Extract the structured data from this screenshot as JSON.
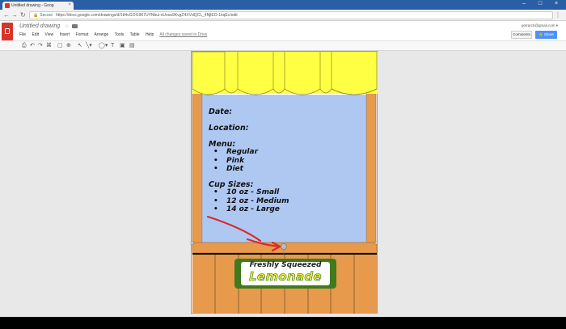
{
  "browser": {
    "tab_title": "Untitled drawing - Goog",
    "secure_label": "Secure",
    "url": "https://docs.google.com/drawings/d/1tt4vGOI1967UYNbui-sUnus9KvgZ4XVdQCL_4NjlEO-1kqEc/edit"
  },
  "docs": {
    "title": "Untitled drawing",
    "menu": [
      "File",
      "Edit",
      "View",
      "Insert",
      "Format",
      "Arrange",
      "Tools",
      "Table",
      "Help"
    ],
    "saved_status": "All changes saved in Drive",
    "account": "petrarch@gmail.com",
    "comments_label": "Comments",
    "share_label": "Share"
  },
  "drawing": {
    "date_label": "Date:",
    "location_label": "Location:",
    "menu_label": "Menu:",
    "menu_items": [
      "Regular",
      "Pink",
      "Diet"
    ],
    "cup_label": "Cup Sizes:",
    "cup_items": [
      "10 oz - Small",
      "12 oz - Medium",
      "14 oz - Large"
    ],
    "sign_top": "Freshly Squeezed",
    "sign_main": "Lemonade"
  },
  "colors": {
    "awning": "#ffff44",
    "board": "#aec8f2",
    "wood": "#e79a4c",
    "sign_frame": "#3f7a1e",
    "arrow": "#d92a2a",
    "share": "#4d90fe"
  }
}
